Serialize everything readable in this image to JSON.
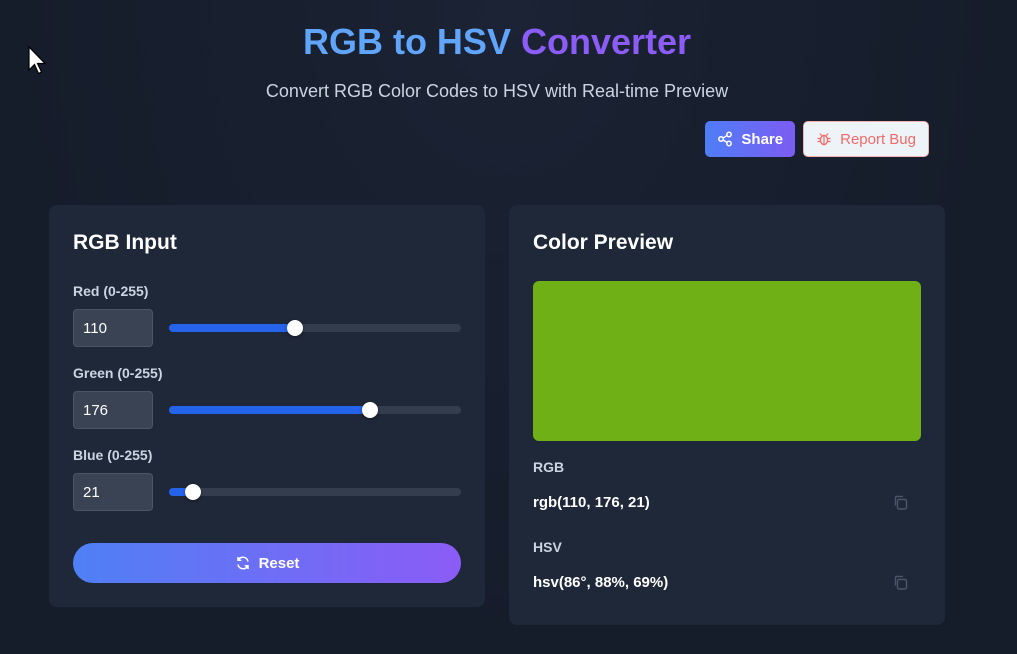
{
  "header": {
    "title_part1": "RGB to HSV",
    "title_part2": "Converter",
    "subtitle": "Convert RGB Color Codes to HSV with Real-time Preview"
  },
  "actions": {
    "share_label": "Share",
    "share_icon": "share-icon",
    "report_label": "Report Bug",
    "report_icon": "bug-icon"
  },
  "rgb_input": {
    "title": "RGB Input",
    "red": {
      "label": "Red (0-255)",
      "value": "110",
      "fraction": 0.431
    },
    "green": {
      "label": "Green (0-255)",
      "value": "176",
      "fraction": 0.69
    },
    "blue": {
      "label": "Blue (0-255)",
      "value": "21",
      "fraction": 0.082
    },
    "reset_label": "Reset",
    "reset_icon": "refresh-icon"
  },
  "preview": {
    "title": "Color Preview",
    "color": "#6eb015",
    "rgb_label": "RGB",
    "rgb_value": "rgb(110, 176, 21)",
    "hsv_label": "HSV",
    "hsv_value": "hsv(86°, 88%, 69%)",
    "copy_icon": "copy-icon"
  },
  "colors": {
    "accent_blue": "#2563eb",
    "gradient_start": "#4f80f5",
    "gradient_end": "#8b5cf6",
    "bug_red": "#ef6b6b"
  }
}
